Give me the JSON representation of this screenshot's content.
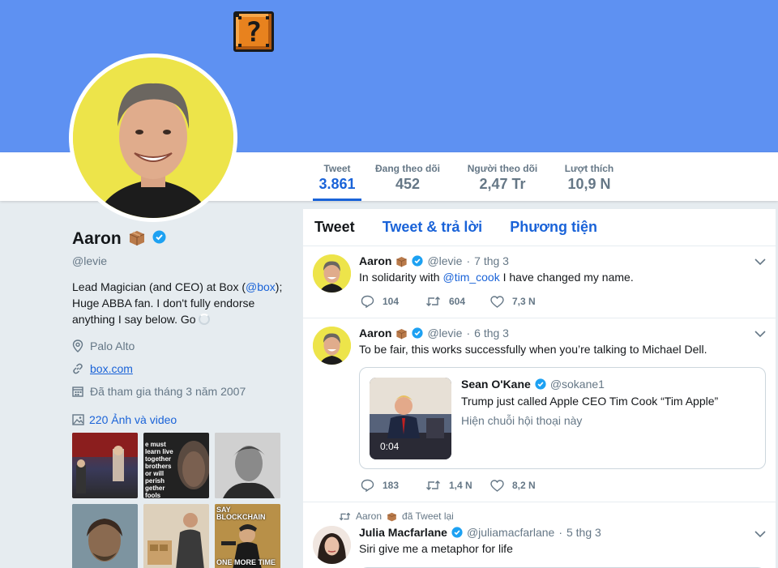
{
  "banner": {
    "color": "#5e91f2",
    "block_symbol": "?"
  },
  "profile_nav": {
    "stats": [
      {
        "label": "Tweet",
        "value": "3.861",
        "active": true
      },
      {
        "label": "Đang theo dõi",
        "value": "452"
      },
      {
        "label": "Người theo dõi",
        "value": "2,47 Tr"
      },
      {
        "label": "Lượt thích",
        "value": "10,9 N"
      }
    ]
  },
  "profile": {
    "name": "Aaron",
    "handle": "@levie",
    "bio_before": "Lead Magician (and CEO) at Box (",
    "bio_link": "@box",
    "bio_after": "); Huge ABBA fan. I don't fully endorse anything I say below. Go",
    "location": "Palo Alto",
    "website": "box.com",
    "joined": "Đã tham gia tháng 3 năm 2007",
    "photos_link": "220 Ảnh và video",
    "thumb_texts": {
      "t2": "e must learn live together brothers or will perish gether fools",
      "t6_top": "SAY BLOCKCHAIN",
      "t6_bottom": "ONE MORE TIME"
    }
  },
  "timeline": {
    "tabs": [
      "Tweet",
      "Tweet & trả lời",
      "Phương tiện"
    ],
    "tweets": [
      {
        "name": "Aaron",
        "handle": "@levie",
        "dot": "·",
        "date": "7 thg 3",
        "text_before": "In solidarity with ",
        "mention": "@tim_cook",
        "text_after": " I have changed my name.",
        "replies": "104",
        "retweets": "604",
        "likes": "7,3 N"
      },
      {
        "name": "Aaron",
        "handle": "@levie",
        "dot": "·",
        "date": "6 thg 3",
        "text": "To be fair, this works successfully when you’re talking to Michael Dell.",
        "quote": {
          "name": "Sean O'Kane",
          "handle": "@sokane1",
          "text": "Trump just called Apple CEO Tim Cook “Tim Apple”",
          "thread_link": "Hiện chuỗi hội thoại này",
          "video_time": "0:04"
        },
        "replies": "183",
        "retweets": "1,4 N",
        "likes": "8,2 N"
      },
      {
        "retweeted_by": "Aaron",
        "retweeted_label": "đã Tweet lại",
        "name": "Julia Macfarlane",
        "handle": "@juliamacfarlane",
        "dot": "·",
        "date": "5 thg 3",
        "text": "Siri give me a metaphor for life"
      }
    ]
  }
}
